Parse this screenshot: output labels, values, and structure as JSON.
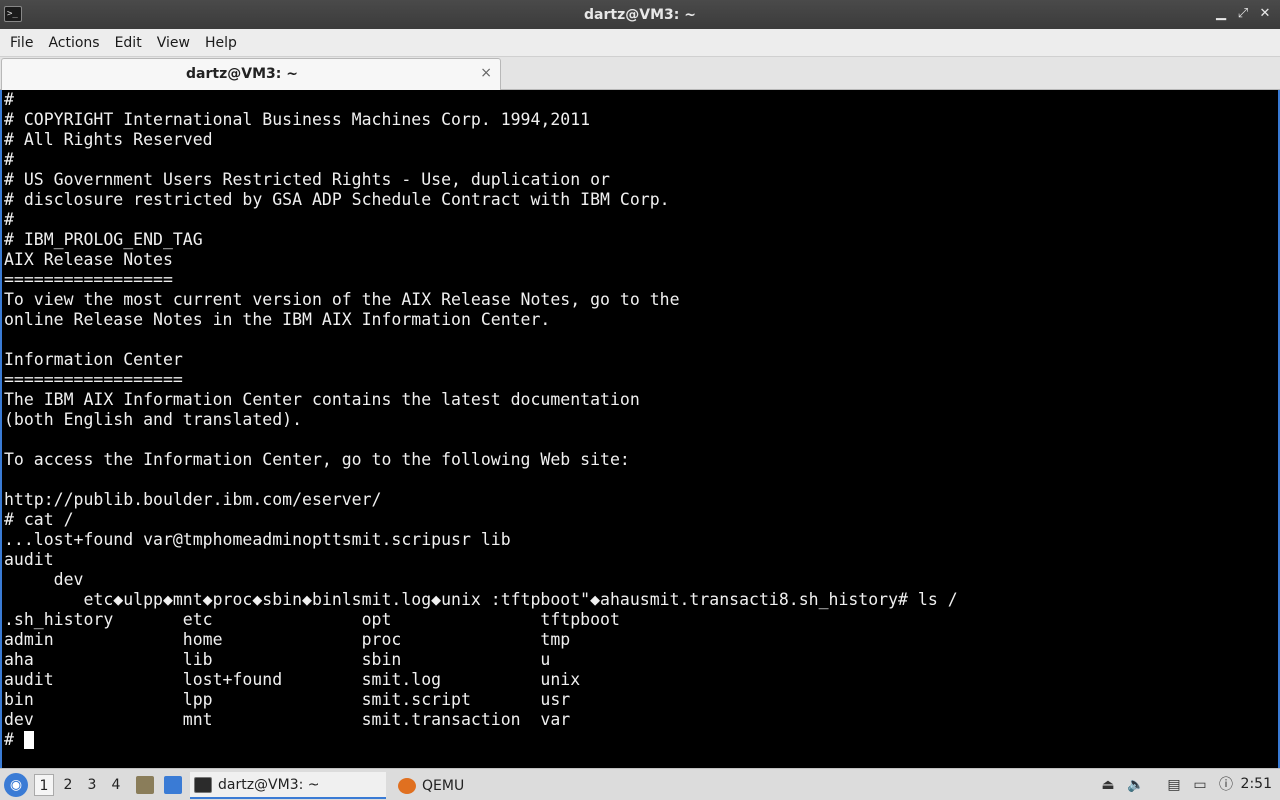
{
  "window": {
    "title": "dartz@VM3: ~",
    "app_icon": ">_"
  },
  "menubar": {
    "items": [
      "File",
      "Actions",
      "Edit",
      "View",
      "Help"
    ]
  },
  "tabs": [
    {
      "label": "dartz@VM3: ~",
      "close": "×"
    }
  ],
  "terminal": {
    "lines": [
      "#",
      "# COPYRIGHT International Business Machines Corp. 1994,2011",
      "# All Rights Reserved",
      "#",
      "# US Government Users Restricted Rights - Use, duplication or",
      "# disclosure restricted by GSA ADP Schedule Contract with IBM Corp.",
      "#",
      "# IBM_PROLOG_END_TAG",
      "AIX Release Notes",
      "=================",
      "To view the most current version of the AIX Release Notes, go to the",
      "online Release Notes in the IBM AIX Information Center.",
      "",
      "Information Center",
      "==================",
      "The IBM AIX Information Center contains the latest documentation",
      "(both English and translated).",
      "",
      "To access the Information Center, go to the following Web site:",
      "",
      "http://publib.boulder.ibm.com/eserver/",
      "# cat /",
      "...lost+found var@tmphomeadminopttsmit.scripusr lib",
      "audit",
      "     dev",
      "        etc◆ulpp◆mnt◆proc◆sbin◆binlsmit.log◆unix :tftpboot\"◆ahausmit.transacti8.sh_history# ls /",
      ".sh_history       etc               opt               tftpboot",
      "admin             home              proc              tmp",
      "aha               lib               sbin              u",
      "audit             lost+found        smit.log          unix",
      "bin               lpp               smit.script       usr",
      "dev               mnt               smit.transaction  var"
    ],
    "prompt": "# "
  },
  "taskbar": {
    "workspaces": [
      "1",
      "2",
      "3",
      "4"
    ],
    "active_workspace": "1",
    "tasks": [
      {
        "label": "dartz@VM3: ~",
        "icon": "terminal-icon"
      },
      {
        "label": "QEMU",
        "icon": "qemu-icon"
      }
    ],
    "clock": "2:51"
  },
  "colors": {
    "terminal_bg": "#000000",
    "terminal_fg": "#f0f0f0",
    "accent": "#3a7bd5"
  }
}
